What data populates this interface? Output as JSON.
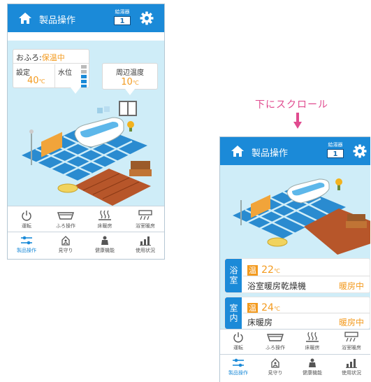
{
  "header": {
    "title": "製品操作",
    "water_heater_label": "給湯器",
    "water_heater_number": "1"
  },
  "bath_status": {
    "prefix": "おふろ:",
    "state": "保温中",
    "setting_label": "設定",
    "setting_value": "40",
    "setting_unit": "℃",
    "water_level_label": "水位",
    "water_level_fraction": 0.6
  },
  "ambient": {
    "label": "周辺温度",
    "value": "10",
    "unit": "℃"
  },
  "scroll_hint": "下にスクロール",
  "bathroom_card": {
    "side_label": "浴室",
    "temp_badge": "温",
    "temp_value": "22",
    "temp_unit": "℃",
    "device_name": "浴室暖房乾燥機",
    "device_status": "暖房中"
  },
  "room_card": {
    "side_label": "室内",
    "temp_badge": "温",
    "temp_value": "24",
    "temp_unit": "℃",
    "device_name": "床暖房",
    "device_status": "暖房中"
  },
  "toolbar_top": [
    {
      "label": "運転",
      "icon": "power-icon"
    },
    {
      "label": "ふろ操作",
      "icon": "bathtub-icon"
    },
    {
      "label": "床暖房",
      "icon": "floor-heating-icon"
    },
    {
      "label": "浴室暖房",
      "icon": "bathroom-heater-icon"
    }
  ],
  "toolbar_bottom": [
    {
      "label": "製品操作",
      "icon": "sliders-icon",
      "active": true
    },
    {
      "label": "見守り",
      "icon": "watch-icon",
      "active": false
    },
    {
      "label": "健康機能",
      "icon": "health-icon",
      "active": false
    },
    {
      "label": "使用状況",
      "icon": "bar-chart-icon",
      "active": false
    }
  ],
  "colors": {
    "brand_blue": "#1b8ad8",
    "accent_orange": "#f39a1e",
    "scene_background": "#cfedf8",
    "scroll_hint_pink": "#e04b8f"
  }
}
